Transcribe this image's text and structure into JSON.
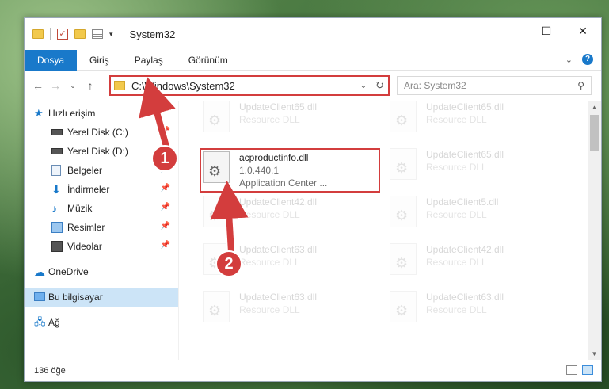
{
  "window": {
    "title": "System32",
    "controls": {
      "minimize": "—",
      "maximize": "☐",
      "close": "✕"
    }
  },
  "ribbon": {
    "tabs": [
      "Dosya",
      "Giriş",
      "Paylaş",
      "Görünüm"
    ],
    "help": "?"
  },
  "address": {
    "path": "C:\\Windows\\System32",
    "search_placeholder": "Ara: System32"
  },
  "nav": {
    "items": [
      {
        "label": "Hızlı erişim",
        "icon": "star-icon"
      },
      {
        "label": "Yerel Disk (C:)",
        "icon": "drive-icon",
        "pinned": true
      },
      {
        "label": "Yerel Disk (D:)",
        "icon": "drive-icon"
      },
      {
        "label": "Belgeler",
        "icon": "document-icon",
        "pinned": true
      },
      {
        "label": "İndirmeler",
        "icon": "download-icon",
        "pinned": true
      },
      {
        "label": "Müzik",
        "icon": "music-icon",
        "pinned": true
      },
      {
        "label": "Resimler",
        "icon": "pictures-icon",
        "pinned": true
      },
      {
        "label": "Videolar",
        "icon": "video-icon",
        "pinned": true
      },
      {
        "label": "OneDrive",
        "icon": "cloud-icon"
      },
      {
        "label": "Bu bilgisayar",
        "icon": "computer-icon"
      },
      {
        "label": "Ağ",
        "icon": "network-icon"
      }
    ]
  },
  "files": {
    "main": {
      "name": "acproductinfo.dll",
      "version": "1.0.440.1",
      "desc": "Application Center ..."
    },
    "background": [
      {
        "name": "UpdateClient65.dll",
        "desc": "Resource DLL"
      },
      {
        "name": "UpdateClient65.dll",
        "desc": "Resource DLL"
      },
      {
        "name": "UpdateClient65.dll",
        "desc": "Resource DLL"
      },
      {
        "name": "UpdateClient42.dll",
        "desc": "Resource DLL"
      },
      {
        "name": "UpdateClient5.dll",
        "desc": "Resource DLL"
      },
      {
        "name": "UpdateClient63.dll",
        "desc": "Resource DLL"
      },
      {
        "name": "UpdateClient42.dll",
        "desc": "Resource DLL"
      },
      {
        "name": "UpdateClient63.dll",
        "desc": "Resource DLL"
      },
      {
        "name": "UpdateClient63.dll",
        "desc": "Resource DLL"
      }
    ]
  },
  "status": {
    "count": "136 öğe"
  },
  "annotations": {
    "step1": "1",
    "step2": "2",
    "accent": "#d33d3d"
  }
}
